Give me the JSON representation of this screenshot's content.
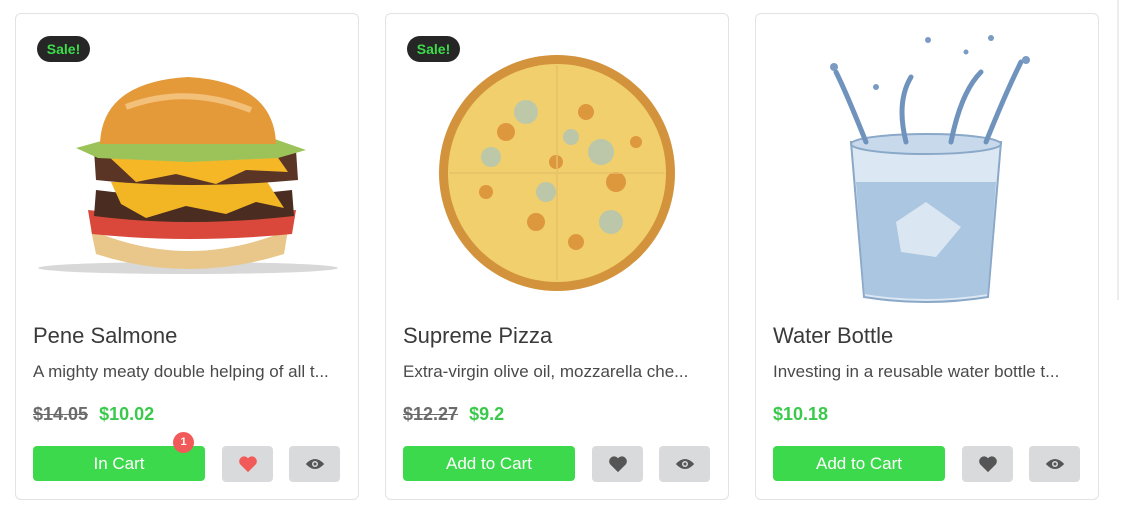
{
  "products": [
    {
      "sale_badge": "Sale!",
      "name": "Pene Salmone",
      "description": "A mighty meaty double helping of all t...",
      "old_price": "$14.05",
      "price": "$10.02",
      "cart_label": "In Cart",
      "cart_count": "1",
      "favorite": true,
      "image": "burger"
    },
    {
      "sale_badge": "Sale!",
      "name": "Supreme Pizza",
      "description": "Extra-virgin olive oil, mozzarella che...",
      "old_price": "$12.27",
      "price": "$9.2",
      "cart_label": "Add to Cart",
      "favorite": false,
      "image": "pizza"
    },
    {
      "name": "Water Bottle",
      "description": "Investing in a reusable water bottle t...",
      "price": "$10.18",
      "cart_label": "Add to Cart",
      "favorite": false,
      "image": "water-glass"
    }
  ],
  "colors": {
    "accent_green": "#3cd94c",
    "price_green": "#3bc94b",
    "favorite_active": "#f25a5a",
    "icon_inactive": "#555555",
    "badge_bg": "#262626"
  },
  "icons": {
    "favorite": "heart-icon",
    "quick_view": "eye-icon"
  }
}
